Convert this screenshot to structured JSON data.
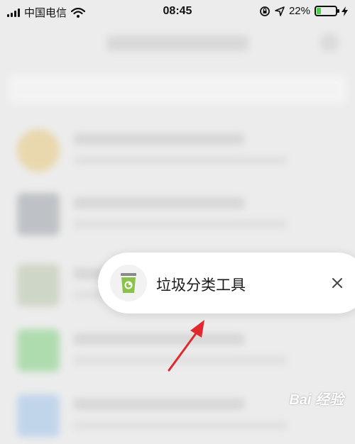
{
  "status_bar": {
    "carrier": "中国电信",
    "time": "08:45",
    "battery_percent": "22%",
    "battery_level": 0.22,
    "icons": [
      "signal-icon",
      "wifi-icon",
      "rotation-lock-icon",
      "location-arrow-icon",
      "battery-icon",
      "charging-icon"
    ]
  },
  "toast": {
    "app_name": "垃圾分类工具",
    "app_icon": "trash-bin-icon",
    "close_icon": "close-icon"
  },
  "watermark": {
    "text": "Bai 经验"
  },
  "colors": {
    "accent_green": "#8bc34a",
    "arrow_red": "#e0282e",
    "battery_green": "#4bd04b"
  }
}
